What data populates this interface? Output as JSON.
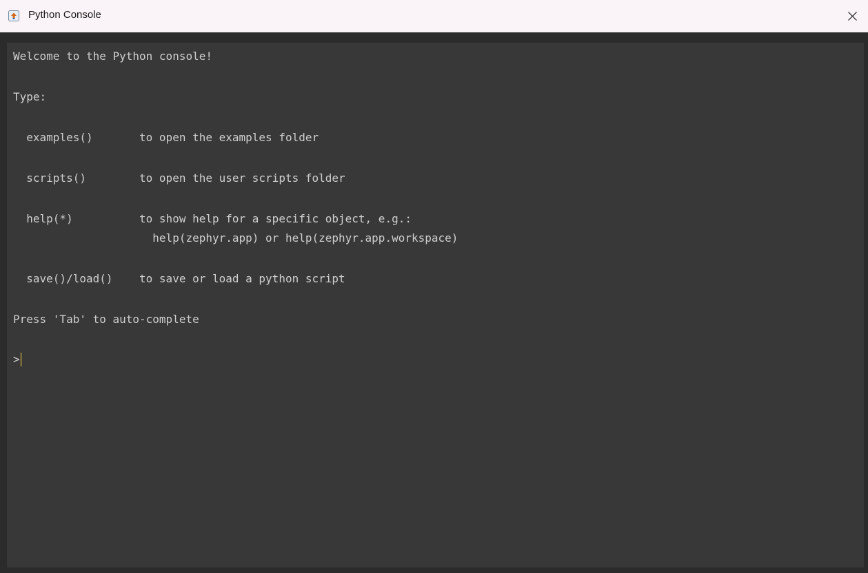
{
  "window": {
    "title": "Python Console",
    "app_icon": "python-console-icon",
    "close_icon": "close-icon"
  },
  "colors": {
    "titlebar_bg": "#faf3f7",
    "console_bg": "#383838",
    "frame_bg": "#2b2b2b",
    "text": "#cfcfcf",
    "caret": "#ffd23c"
  },
  "console": {
    "lines": [
      "Welcome to the Python console!",
      "Type:",
      "  examples()       to open the examples folder",
      "  scripts()        to open the user scripts folder",
      "  help(*)          to show help for a specific object, e.g.:",
      "                     help(zephyr.app) or help(zephyr.app.workspace)",
      "  save()/load()    to save or load a python script",
      "Press 'Tab' to auto-complete"
    ],
    "prompt": ">",
    "input_value": ""
  }
}
